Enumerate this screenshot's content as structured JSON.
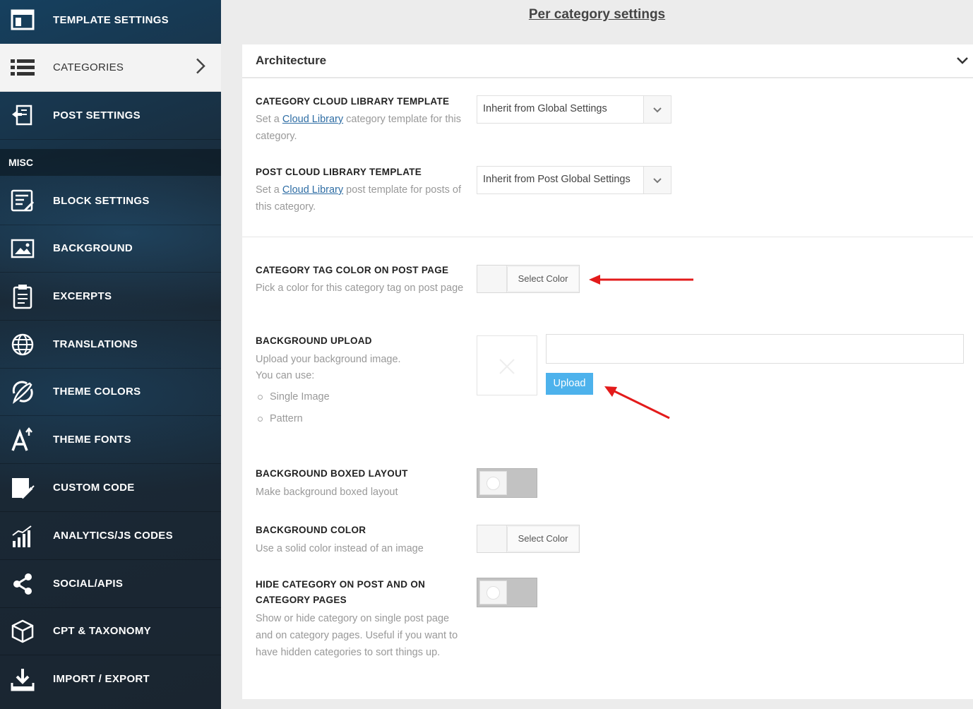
{
  "sidebar": {
    "items": [
      {
        "label": "TEMPLATE SETTINGS",
        "icon": "template-icon"
      },
      {
        "label": "CATEGORIES",
        "icon": "list-icon"
      },
      {
        "label": "POST SETTINGS",
        "icon": "post-settings-icon"
      }
    ],
    "misc_heading": "MISC",
    "misc_items": [
      {
        "label": "BLOCK SETTINGS",
        "icon": "block-settings-icon"
      },
      {
        "label": "BACKGROUND",
        "icon": "image-icon"
      },
      {
        "label": "EXCERPTS",
        "icon": "clipboard-icon"
      },
      {
        "label": "TRANSLATIONS",
        "icon": "globe-icon"
      },
      {
        "label": "THEME COLORS",
        "icon": "brush-icon"
      },
      {
        "label": "THEME FONTS",
        "icon": "font-icon"
      },
      {
        "label": "CUSTOM CODE",
        "icon": "code-icon"
      },
      {
        "label": "ANALYTICS/JS CODES",
        "icon": "analytics-icon"
      },
      {
        "label": "SOCIAL/APIS",
        "icon": "share-icon"
      },
      {
        "label": "CPT & TAXONOMY",
        "icon": "cube-icon"
      },
      {
        "label": "IMPORT / EXPORT",
        "icon": "download-icon"
      }
    ],
    "active": "CATEGORIES"
  },
  "main": {
    "page_title": "Per category settings",
    "panel_title": "Architecture",
    "options": {
      "cat_template": {
        "title": "CATEGORY CLOUD LIBRARY TEMPLATE",
        "desc_pre": "Set a ",
        "desc_link": "Cloud Library",
        "desc_post": " category template for this category.",
        "value": "Inherit from Global Settings"
      },
      "post_template": {
        "title": "POST CLOUD LIBRARY TEMPLATE",
        "desc_pre": "Set a ",
        "desc_link": "Cloud Library",
        "desc_post": " post template for posts of this category.",
        "value": "Inherit from Post Global Settings"
      },
      "tag_color": {
        "title": "CATEGORY TAG COLOR ON POST PAGE",
        "desc": "Pick a color for this category tag on post page",
        "button": "Select Color"
      },
      "bg_upload": {
        "title": "BACKGROUND UPLOAD",
        "desc1": "Upload your background image.",
        "desc2": "You can use:",
        "list": [
          "Single Image",
          "Pattern"
        ],
        "input_value": "",
        "button": "Upload"
      },
      "boxed": {
        "title": "BACKGROUND BOXED LAYOUT",
        "desc": "Make background boxed layout",
        "enabled": false
      },
      "bg_color": {
        "title": "BACKGROUND COLOR",
        "desc": "Use a solid color instead of an image",
        "button": "Select Color"
      },
      "hide_cat": {
        "title": "HIDE CATEGORY ON POST AND ON CATEGORY PAGES",
        "desc": "Show or hide category on single post page and on category pages. Useful if you want to have hidden categories to sort things up.",
        "enabled": false
      }
    }
  },
  "colors": {
    "accent": "#4db2ec",
    "annotation_arrow": "#e31b1b",
    "link": "#2e6da4"
  }
}
